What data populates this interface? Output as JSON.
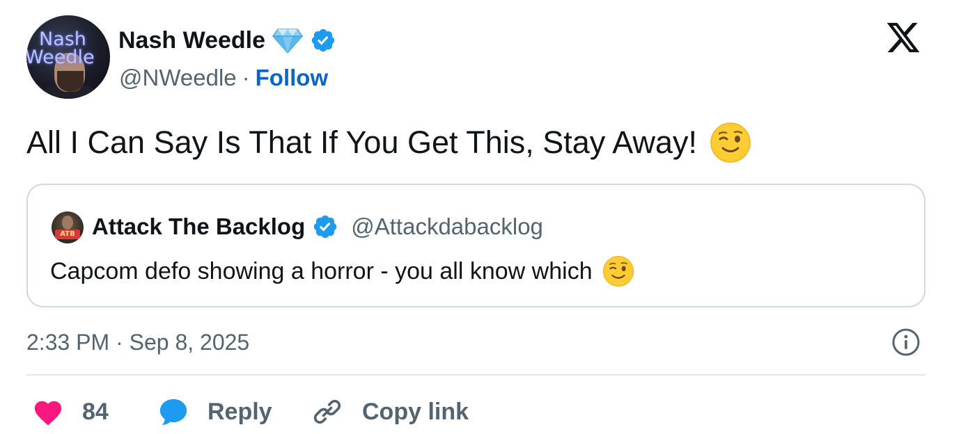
{
  "author": {
    "display_name": "Nash Weedle",
    "handle": "@NWeedle",
    "separator": "·",
    "follow_label": "Follow",
    "avatar_logo_line1": "Nash",
    "avatar_logo_line2": "Weedle",
    "badges": [
      "diamond-icon",
      "verified-icon"
    ]
  },
  "platform_logo": "x-logo",
  "tweet": {
    "text": "All I Can Say Is That If You Get This, Stay Away!",
    "emoji": "winking-face"
  },
  "quoted_tweet": {
    "display_name": "Attack The Backlog",
    "handle": "@Attackdabacklog",
    "avatar_badge_text": "ATB",
    "text": "Capcom defo showing a horror - you all know which",
    "emoji": "winking-face"
  },
  "timestamp": "2:33 PM · Sep 8, 2025",
  "actions": {
    "like_count": "84",
    "reply_label": "Reply",
    "copy_link_label": "Copy link"
  },
  "colors": {
    "verified_blue": "#1d9bf0",
    "follow_blue": "#0a66c9",
    "like_pink": "#f91880",
    "reply_blue": "#1d9bf0",
    "muted_text": "#536471",
    "border": "#cfd9de"
  }
}
